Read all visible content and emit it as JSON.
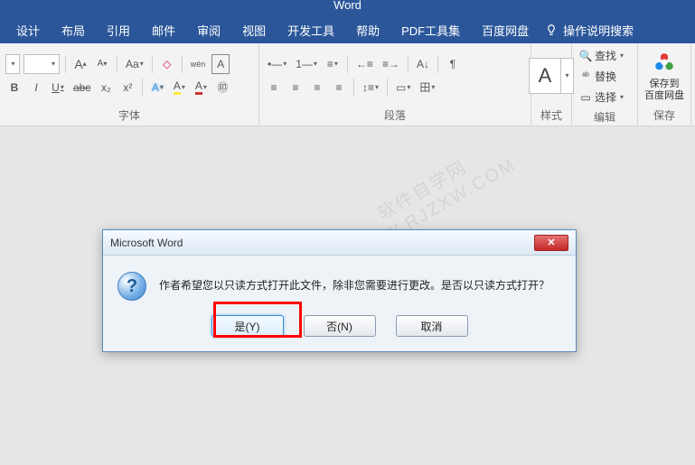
{
  "app_title": "Word",
  "menu": [
    "设计",
    "布局",
    "引用",
    "邮件",
    "审阅",
    "视图",
    "开发工具",
    "帮助",
    "PDF工具集",
    "百度网盘"
  ],
  "tell_me": "操作说明搜索",
  "ribbon": {
    "font": {
      "label": "字体",
      "inc": "A",
      "dec": "A",
      "case": "Aa",
      "clear": "◇",
      "phonetic": "wén",
      "charborder": "A",
      "bold": "B",
      "italic": "I",
      "underline": "U",
      "strike": "abc",
      "sub": "x₂",
      "sup": "x²",
      "texteffect": "A",
      "highlight": "A",
      "fontcolor": "A",
      "circled": "㊞"
    },
    "para": {
      "label": "段落",
      "bullets": "•—",
      "numbers": "1—",
      "multilevel": "≡",
      "dedent": "←≡",
      "indent": "≡→",
      "sort": "A↓",
      "show": "¶",
      "al_left": "≡",
      "al_center": "≡",
      "al_right": "≡",
      "al_just": "≡",
      "linesp": "↕≡",
      "shading": "▭",
      "borders": "田"
    },
    "style": {
      "label": "样式",
      "glyph": "A"
    },
    "edit": {
      "label": "编辑",
      "find": "查找",
      "replace": "替换",
      "select": "选择"
    },
    "save": {
      "label": "保存",
      "line1": "保存到",
      "line2": "百度网盘"
    }
  },
  "watermark": {
    "l1": "软件自学网",
    "l2": "WWW.RJZXW.COM"
  },
  "dialog": {
    "title": "Microsoft Word",
    "message": "作者希望您以只读方式打开此文件，除非您需要进行更改。是否以只读方式打开？",
    "yes": "是(Y)",
    "no": "否(N)",
    "cancel": "取消"
  }
}
